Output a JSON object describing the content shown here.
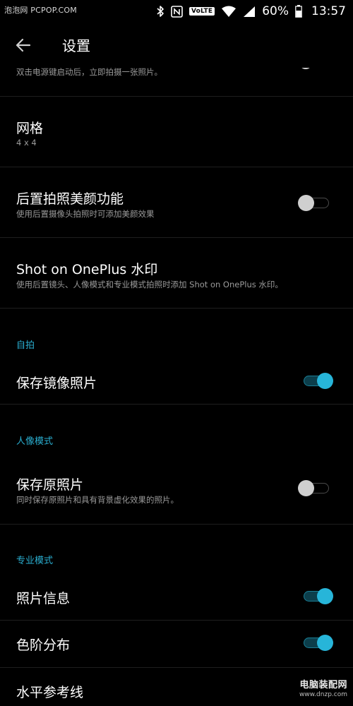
{
  "status_bar": {
    "watermark": "泡泡网 PCPOP.COM",
    "icons": [
      "bluetooth-icon",
      "nfc-icon",
      "volte-badge",
      "wifi-icon",
      "signal-icon",
      "battery-icon"
    ],
    "volte_label": "VoLTE",
    "battery": "60%",
    "time": "13:57"
  },
  "app_bar": {
    "back_icon": "arrow-back-icon",
    "title": "设置"
  },
  "partial_row": {
    "subtitle": "双击电源键启动后，立即拍摄一张照片。"
  },
  "rows": {
    "grid": {
      "title": "网格",
      "subtitle": "4 x 4"
    },
    "rear_beauty": {
      "title": "后置拍照美颜功能",
      "subtitle": "使用后置摄像头拍照时可添加美颜效果",
      "enabled": false
    },
    "shot_on_watermark": {
      "title": "Shot on OnePlus 水印",
      "subtitle": "使用后置镜头、人像模式和专业模式拍照时添加 Shot on OnePlus 水印。"
    },
    "save_mirror": {
      "title": "保存镜像照片",
      "enabled": true
    },
    "save_original": {
      "title": "保存原照片",
      "subtitle": "同时保存原照片和具有背景虚化效果的照片。",
      "enabled": false
    },
    "photo_info": {
      "title": "照片信息",
      "enabled": true
    },
    "histogram": {
      "title": "色阶分布",
      "enabled": true
    },
    "horizon_line": {
      "title": "水平参考线"
    }
  },
  "sections": {
    "selfie": "自拍",
    "portrait": "人像模式",
    "pro": "专业模式"
  },
  "colors": {
    "background": "#000000",
    "accent": "#27b5d9",
    "secondary_text": "#9a9a9a",
    "divider": "#1e1e1e"
  },
  "watermark_bottom": {
    "main": "电脑装配网",
    "url": "www.dnzp.com"
  }
}
